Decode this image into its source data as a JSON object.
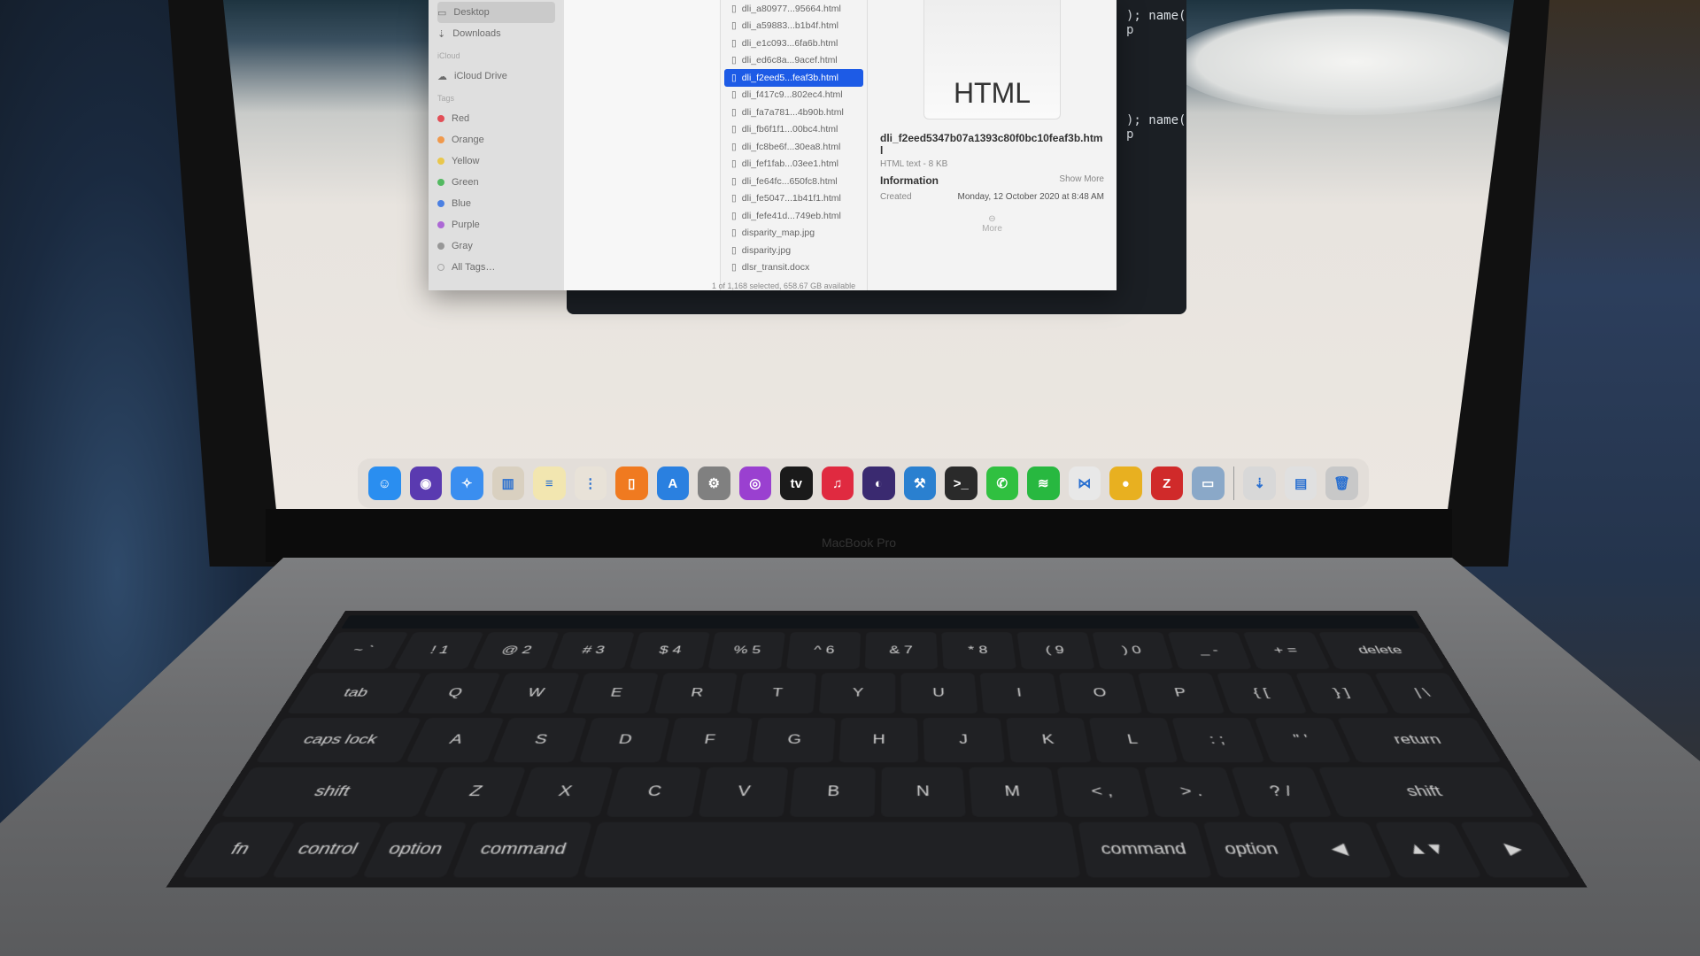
{
  "finder": {
    "sidebar": {
      "items": [
        {
          "label": "Desktop",
          "selected": true
        },
        {
          "label": "Downloads"
        }
      ],
      "icloud_header": "iCloud",
      "icloud_items": [
        {
          "label": "iCloud Drive"
        }
      ],
      "tags_header": "Tags",
      "tags": [
        {
          "label": "Red",
          "color": "#e0323c"
        },
        {
          "label": "Orange",
          "color": "#f08a30"
        },
        {
          "label": "Yellow",
          "color": "#e8c030"
        },
        {
          "label": "Green",
          "color": "#38b048"
        },
        {
          "label": "Blue",
          "color": "#2e6de0"
        },
        {
          "label": "Purple",
          "color": "#a050d0"
        },
        {
          "label": "Gray",
          "color": "#888888"
        },
        {
          "label": "All Tags…",
          "color": ""
        }
      ]
    },
    "files": [
      {
        "name": "dli_a80977...95664.html"
      },
      {
        "name": "dli_a59883...b1b4f.html"
      },
      {
        "name": "dli_e1c093...6fa6b.html"
      },
      {
        "name": "dli_ed6c8a...9acef.html"
      },
      {
        "name": "dli_f2eed5...feaf3b.html",
        "selected": true
      },
      {
        "name": "dli_f417c9...802ec4.html"
      },
      {
        "name": "dli_fa7a781...4b90b.html"
      },
      {
        "name": "dli_fb6f1f1...00bc4.html"
      },
      {
        "name": "dli_fc8be6f...30ea8.html"
      },
      {
        "name": "dli_fef1fab...03ee1.html"
      },
      {
        "name": "dli_fe64fc...650fc8.html"
      },
      {
        "name": "dli_fe5047...1b41f1.html"
      },
      {
        "name": "dli_fefe41d...749eb.html"
      },
      {
        "name": "disparity_map.jpg"
      },
      {
        "name": "disparity.jpg"
      },
      {
        "name": "dlsr_transit.docx"
      }
    ],
    "status_bar": "1 of 1,168 selected, 658.67 GB available",
    "preview": {
      "icon_label": "HTML",
      "filename": "dli_f2eed5347b07a1393c80f0bc10feaf3b.html",
      "kind": "HTML text - 8 KB",
      "information_label": "Information",
      "show_more": "Show More",
      "created_label": "Created",
      "created_value": "Monday, 12 October 2020 at 8:48 AM",
      "more_label": "More"
    }
  },
  "terminal": {
    "line1": "); name( p",
    "line2": "); name( p"
  },
  "dock": {
    "apps": [
      {
        "name": "Finder",
        "color": "#2a8ef0",
        "glyph": "☺"
      },
      {
        "name": "Siri",
        "color": "#5a3ab0",
        "glyph": "◉"
      },
      {
        "name": "Safari",
        "color": "#3a8ef0",
        "glyph": "✧"
      },
      {
        "name": "Launchpad",
        "color": "#d9d0c0",
        "glyph": "▥"
      },
      {
        "name": "Notes",
        "color": "#f2e6b0",
        "glyph": "≡"
      },
      {
        "name": "Reminders",
        "color": "#e8e2d8",
        "glyph": "⋮"
      },
      {
        "name": "Books",
        "color": "#f07a20",
        "glyph": "▯"
      },
      {
        "name": "App Store",
        "color": "#2a80e0",
        "glyph": "A"
      },
      {
        "name": "System Preferences",
        "color": "#808080",
        "glyph": "⚙"
      },
      {
        "name": "Podcasts",
        "color": "#9a40d0",
        "glyph": "◎"
      },
      {
        "name": "TV",
        "color": "#1a1a1a",
        "glyph": "tv"
      },
      {
        "name": "Music",
        "color": "#e02a40",
        "glyph": "♫"
      },
      {
        "name": "Eclipse",
        "color": "#3a2a70",
        "glyph": "◐"
      },
      {
        "name": "Xcode",
        "color": "#2a80d0",
        "glyph": "⚒"
      },
      {
        "name": "Terminal",
        "color": "#2a2a2a",
        "glyph": ">_"
      },
      {
        "name": "WhatsApp",
        "color": "#30c040",
        "glyph": "✆"
      },
      {
        "name": "Spotify",
        "color": "#28b840",
        "glyph": "≋"
      },
      {
        "name": "Visual Studio Code",
        "color": "#e8e8e8",
        "glyph": "⋈"
      },
      {
        "name": "Coin app",
        "color": "#e8b020",
        "glyph": "●"
      },
      {
        "name": "Zotero",
        "color": "#d02a2a",
        "glyph": "Z"
      },
      {
        "name": "Preview",
        "color": "#8aa8c8",
        "glyph": "▭"
      },
      {
        "name": "Downloads folder",
        "color": "#d8d8d8",
        "glyph": "⇣"
      },
      {
        "name": "Documents stack",
        "color": "#e0e0e0",
        "glyph": "▤"
      },
      {
        "name": "Trash",
        "color": "#c8c8c8",
        "glyph": "🗑"
      }
    ]
  },
  "laptop": {
    "brand": "MacBook Pro"
  },
  "keyboard": {
    "rows": [
      [
        "~ `",
        "! 1",
        "@ 2",
        "# 3",
        "$ 4",
        "% 5",
        "^ 6",
        "& 7",
        "* 8",
        "( 9",
        ") 0",
        "_ -",
        "+ =",
        "delete"
      ],
      [
        "tab",
        "Q",
        "W",
        "E",
        "R",
        "T",
        "Y",
        "U",
        "I",
        "O",
        "P",
        "{ [",
        "} ]",
        "| \\"
      ],
      [
        "caps lock",
        "A",
        "S",
        "D",
        "F",
        "G",
        "H",
        "J",
        "K",
        "L",
        ": ;",
        "\" '",
        "return"
      ],
      [
        "shift",
        "Z",
        "X",
        "C",
        "V",
        "B",
        "N",
        "M",
        "< ,",
        "> .",
        "? /",
        "shift"
      ],
      [
        "fn",
        "control",
        "option",
        "command",
        "",
        "command",
        "option",
        "◀",
        "▲▼",
        "▶"
      ]
    ]
  }
}
